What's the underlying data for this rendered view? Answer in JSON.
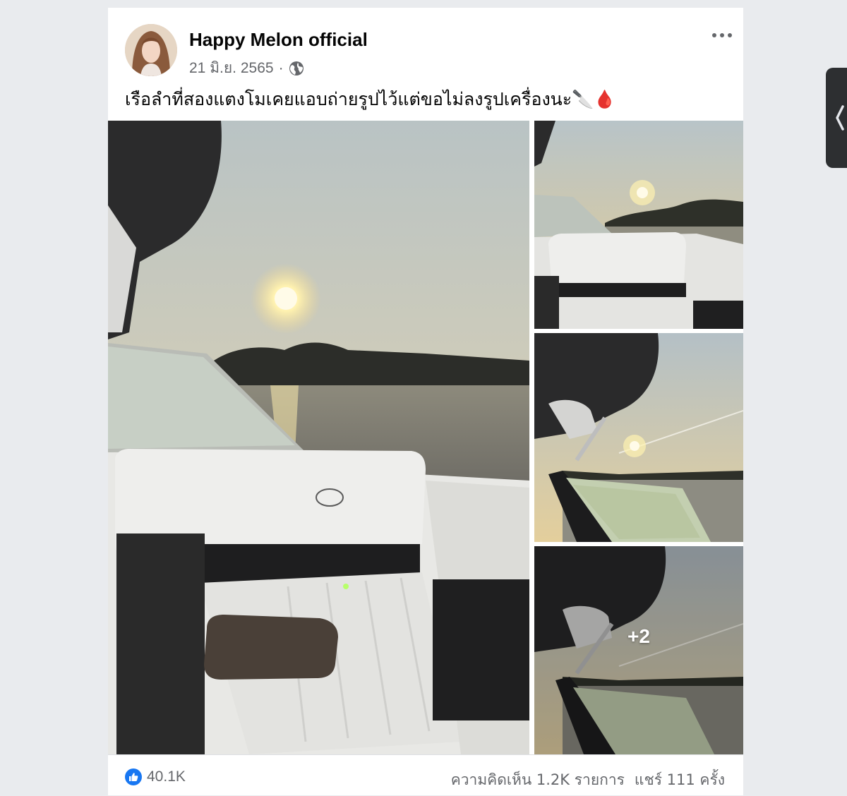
{
  "post": {
    "author": "Happy Melon official",
    "date": "21 มิ.ย. 2565",
    "separator": "·",
    "caption": "เรือลำที่สองแตงโมเคยแอบถ่ายรูปไว้แต่ขอไม่ลงรูปเครื่องนะ🔪🩸",
    "extra_photos": "+2"
  },
  "footer": {
    "likes": "40.1K",
    "comments": "ความคิดเห็น 1.2K รายการ",
    "shares": "แชร์ 111 ครั้ง"
  },
  "icons": {
    "privacy": "globe-icon",
    "menu": "more-horizontal-icon",
    "reaction": "like-icon",
    "side": "chevron-left-icon"
  },
  "colors": {
    "accent": "#1877f2",
    "sky": "#c9cdc4",
    "sun": "#fff2b0",
    "seat": "#ebebe8"
  }
}
